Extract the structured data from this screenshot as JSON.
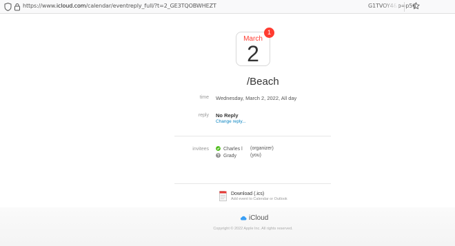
{
  "browser": {
    "url_prefix": "https://www.",
    "url_host": "icloud.com",
    "url_path": "/calendar/eventreply_full/?t=2_GE3TQOBWHEZT",
    "url_tail": "G1TVOY4&p=p56"
  },
  "event": {
    "month": "March",
    "day": "2",
    "badge_count": "1",
    "title": "/Beach",
    "time_label": "time",
    "time_value": "Wednesday, March 2, 2022, All day",
    "reply_label": "reply",
    "reply_status": "No Reply",
    "change_reply": "Change reply...",
    "invitees_label": "invitees",
    "invitees": [
      {
        "name": "Charles l",
        "role": "(organizer)",
        "status_color": "#4cbb17"
      },
      {
        "name": "Grady",
        "role": "(you)",
        "status_color": "#8e8e8e"
      }
    ]
  },
  "download": {
    "title": "Download (.ics)",
    "subtitle": "Add event to Calendar or Outlook"
  },
  "footer": {
    "brand": "iCloud",
    "copyright": "Copyright © 2022 Apple Inc. All rights reserved."
  },
  "colors": {
    "accent": "#ff3b30",
    "link": "#0a84c1"
  }
}
